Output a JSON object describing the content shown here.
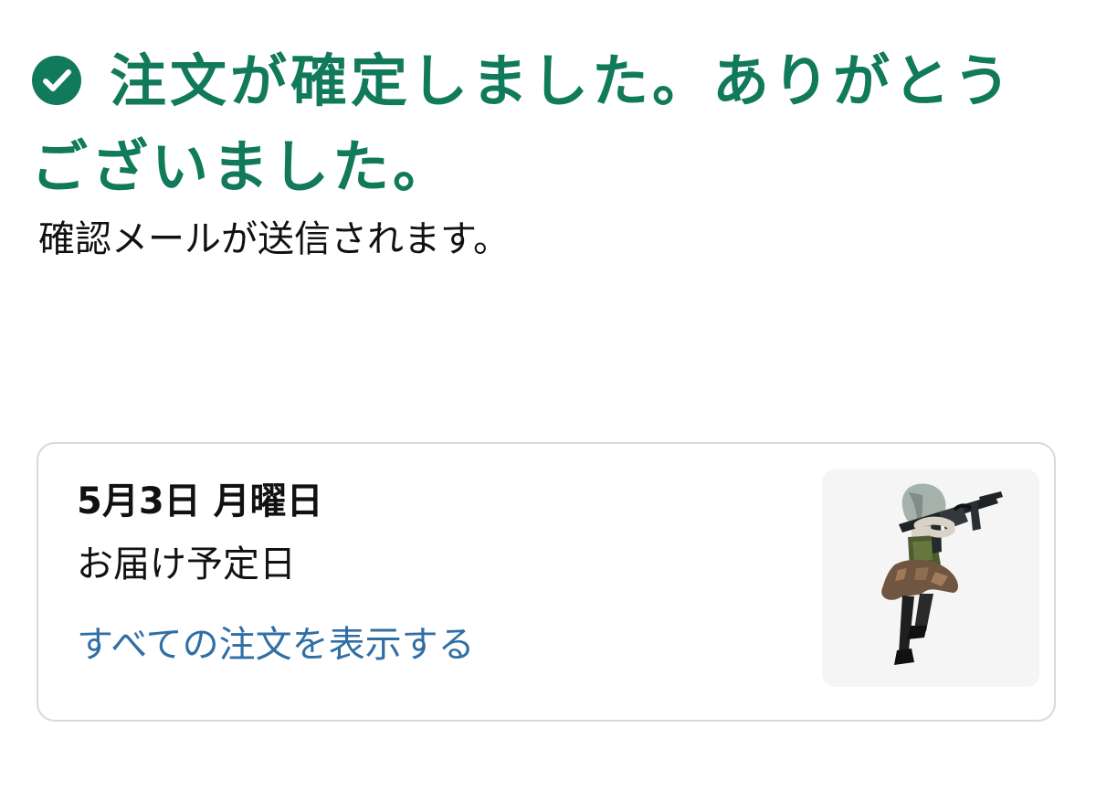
{
  "confirmation": {
    "icon": "check-circle-icon",
    "title": "注文が確定しました。ありがとうございました。",
    "subtitle": "確認メールが送信されます。",
    "accent_color": "#117a5a"
  },
  "order_card": {
    "delivery_date": "5月3日 月曜日",
    "delivery_label": "お届け予定日",
    "view_orders_link": "すべての注文を表示する",
    "link_color": "#2f6fa6",
    "product_image": "product-thumbnail-image"
  }
}
